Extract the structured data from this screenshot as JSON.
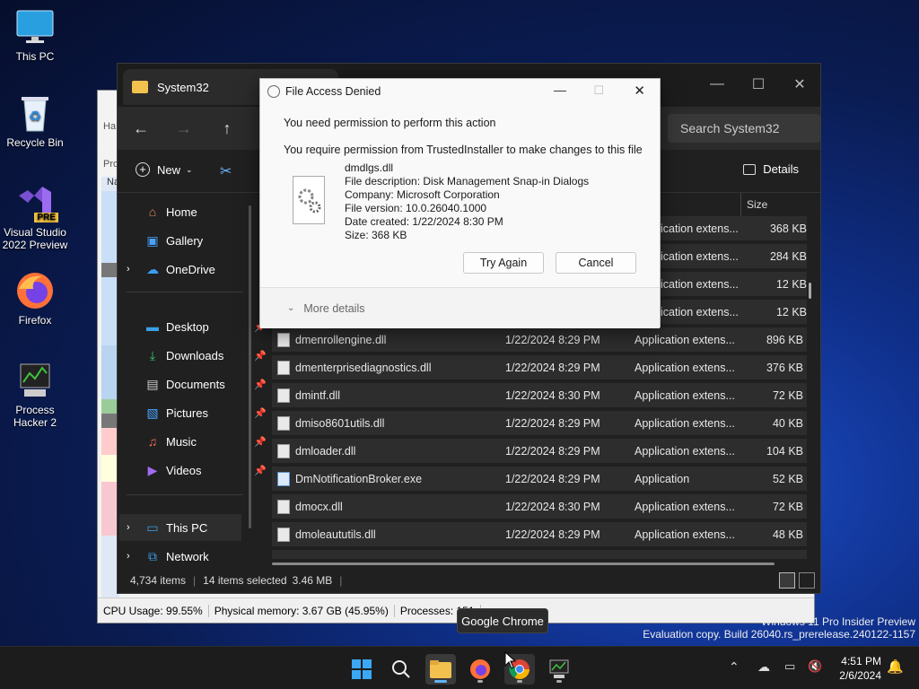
{
  "desktop": {
    "icons": [
      {
        "label": "This PC"
      },
      {
        "label": "Recycle Bin"
      },
      {
        "label": "Visual Studio 2022 Preview",
        "badge": "PRE"
      },
      {
        "label": "Firefox"
      },
      {
        "label": "Process Hacker 2"
      }
    ],
    "watermark": {
      "line1": "Windows 11 Pro Insider Preview",
      "line2": "Evaluation copy. Build 26040.rs_prerelease.240122-1157"
    }
  },
  "process_hacker": {
    "labels": {
      "ha": "Ha",
      "pro": "Pro",
      "na": "Na"
    },
    "status": {
      "cpu": "CPU Usage: 99.55%",
      "memory": "Physical memory: 3.67 GB (45.95%)",
      "processes": "Processes: 151"
    }
  },
  "explorer": {
    "tab_title": "System32",
    "search_placeholder": "Search System32",
    "new_label": "New",
    "details_label": "Details",
    "size_header": "Size",
    "sidebar": [
      {
        "label": "Home",
        "icon": "home-icon"
      },
      {
        "label": "Gallery",
        "icon": "gallery-icon"
      },
      {
        "label": "OneDrive",
        "icon": "cloud-icon"
      },
      {
        "label": "Desktop",
        "icon": "desktop-icon"
      },
      {
        "label": "Downloads",
        "icon": "download-icon"
      },
      {
        "label": "Documents",
        "icon": "document-icon"
      },
      {
        "label": "Pictures",
        "icon": "picture-icon"
      },
      {
        "label": "Music",
        "icon": "music-icon"
      },
      {
        "label": "Videos",
        "icon": "video-icon"
      },
      {
        "label": "This PC",
        "icon": "pc-icon"
      },
      {
        "label": "Network",
        "icon": "network-icon"
      }
    ],
    "partial_rows": [
      {
        "type": "Application extens...",
        "size": "368 KB"
      },
      {
        "type": "Application extens...",
        "size": "284 KB"
      },
      {
        "type": "Application extens...",
        "size": "12 KB"
      },
      {
        "type": "Application extens...",
        "size": "12 KB"
      }
    ],
    "rows": [
      {
        "name": "dmenrollengine.dll",
        "date": "1/22/2024 8:29 PM",
        "type": "Application extens...",
        "size": "896 KB"
      },
      {
        "name": "dmenterprisediagnostics.dll",
        "date": "1/22/2024 8:29 PM",
        "type": "Application extens...",
        "size": "376 KB"
      },
      {
        "name": "dmintf.dll",
        "date": "1/22/2024 8:30 PM",
        "type": "Application extens...",
        "size": "72 KB"
      },
      {
        "name": "dmiso8601utils.dll",
        "date": "1/22/2024 8:29 PM",
        "type": "Application extens...",
        "size": "40 KB"
      },
      {
        "name": "dmloader.dll",
        "date": "1/22/2024 8:29 PM",
        "type": "Application extens...",
        "size": "104 KB"
      },
      {
        "name": "DmNotificationBroker.exe",
        "date": "1/22/2024 8:29 PM",
        "type": "Application",
        "size": "52 KB"
      },
      {
        "name": "dmocx.dll",
        "date": "1/22/2024 8:30 PM",
        "type": "Application extens...",
        "size": "72 KB"
      },
      {
        "name": "dmoleaututils.dll",
        "date": "1/22/2024 8:29 PM",
        "type": "Application extens...",
        "size": "48 KB"
      }
    ],
    "status": {
      "items": "4,734 items",
      "selected": "14 items selected",
      "size": "3.46 MB"
    }
  },
  "dialog": {
    "title": "File Access Denied",
    "heading": "You need permission to perform this action",
    "message": "You require permission from TrustedInstaller to make changes to this file",
    "file_name": "dmdlgs.dll",
    "description": "File description: Disk Management Snap-in Dialogs",
    "company": "Company: Microsoft Corporation",
    "version": "File version: 10.0.26040.1000",
    "created": "Date created: 1/22/2024 8:30 PM",
    "size": "Size: 368 KB",
    "try_again": "Try Again",
    "cancel": "Cancel",
    "more_details": "More details"
  },
  "taskbar": {
    "tooltip": "Google Chrome",
    "time": "4:51 PM",
    "date": "2/6/2024"
  }
}
